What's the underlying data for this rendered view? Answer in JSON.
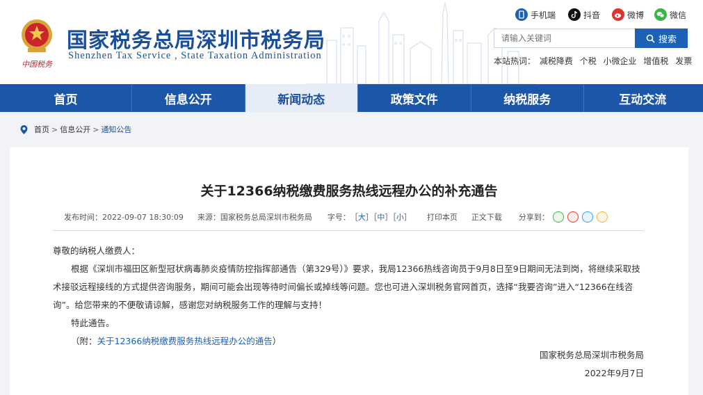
{
  "header": {
    "title": "国家税务总局深圳市税务局",
    "subtitle": "Shenzhen Tax Service , State Taxation Administration",
    "logo_text": "中国税务",
    "social": [
      {
        "label": "手机端",
        "icon": "mobile-icon",
        "color": "#1b62b7"
      },
      {
        "label": "抖音",
        "icon": "douyin-icon",
        "color": "#111111"
      },
      {
        "label": "微博",
        "icon": "weibo-icon",
        "color": "#e0342e"
      },
      {
        "label": "微信",
        "icon": "wechat-icon",
        "color": "#3bb54a"
      }
    ],
    "search": {
      "placeholder": "请输入关键词",
      "button": "搜索"
    },
    "hot": {
      "label": "本站热词：",
      "words": [
        "减税降费",
        "个税",
        "小微企业",
        "增值税",
        "发票"
      ]
    }
  },
  "nav": {
    "items": [
      "首页",
      "信息公开",
      "新闻动态",
      "政策文件",
      "纳税服务",
      "互动交流"
    ],
    "active_index": 2
  },
  "breadcrumb": [
    "首页",
    "信息公开",
    "通知公告"
  ],
  "article": {
    "title": "关于12366纳税缴费服务热线远程办公的补充通告",
    "published": "发布时间：2022-09-07 18:30:09",
    "source": "来源：国家税务总局深圳市税务局",
    "font_label": "字号：",
    "font_sizes": [
      "大",
      "中",
      "小"
    ],
    "print": "打印本页",
    "download": "正文下载",
    "share": "分享到：",
    "greeting": "尊敬的纳税人缴费人：",
    "paragraph": "根据《深圳市福田区新型冠状病毒肺炎疫情防控指挥部通告（第329号）》要求，我局12366热线咨询员于9月8日至9日期间无法到岗，将继续采取技术接驳远程接线的方式提供咨询服务，期间可能会出现等待时间偏长或掉线等问题。您也可进入深圳税务官网首页，选择“我要咨询”进入“12366在线咨询”。给您带来的不便敬请谅解，感谢您对纳税服务工作的理解与支持！",
    "notice": "特此通告。",
    "attach_prefix": "（附：",
    "attach_link": "关于12366纳税缴费服务热线远程办公的通告",
    "attach_suffix": "）",
    "signature": "国家税务总局深圳市税务局",
    "date": "2022年9月7日"
  },
  "colors": {
    "brand": "#1b56a8",
    "accent": "#1b62b7",
    "title": "#1b4f9c"
  }
}
